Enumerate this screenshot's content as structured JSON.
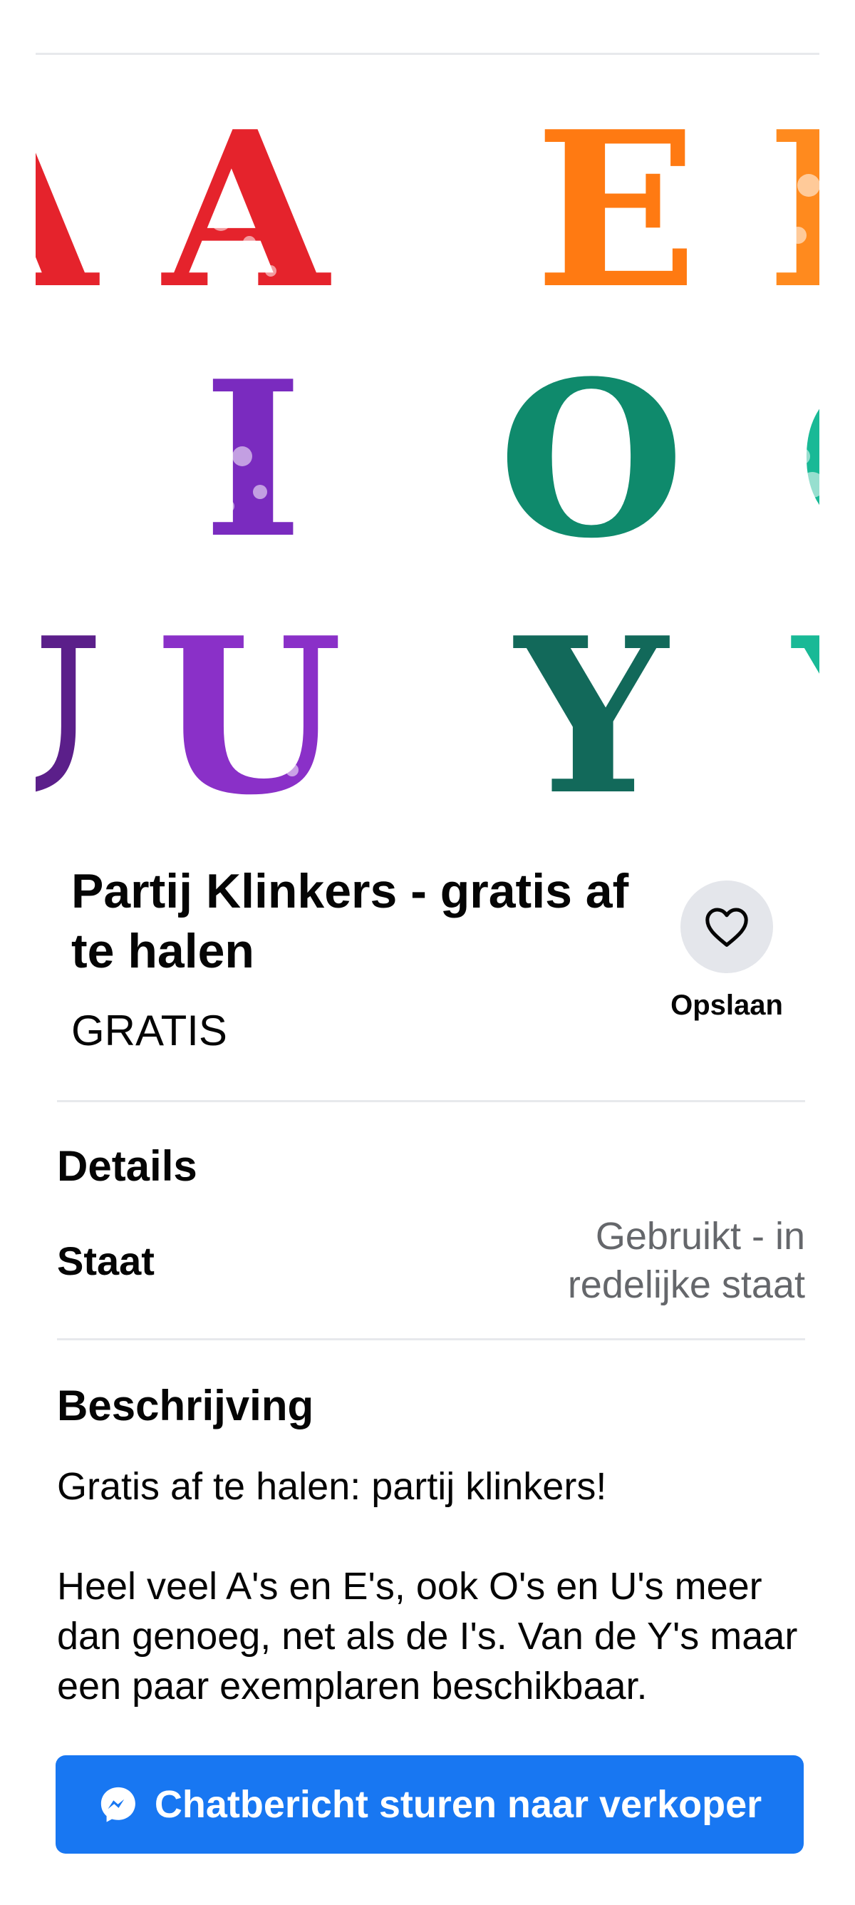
{
  "listing": {
    "title": "Partij Klinkers - gratis af te halen",
    "price": "GRATIS"
  },
  "save": {
    "label": "Opslaan",
    "icon": "heart-outline-icon"
  },
  "details": {
    "heading": "Details",
    "condition_label": "Staat",
    "condition_value": "Gebruikt - in redelijke staat"
  },
  "description": {
    "heading": "Beschrijving",
    "paragraph1": "Gratis af te halen: partij klinkers!",
    "paragraph2": "Heel veel A's en E's, ook O's en U's meer dan genoeg, net als de I's. Van de Y's maar een paar exemplaren beschikbaar."
  },
  "photo": {
    "letters": [
      "A",
      "E",
      "I",
      "O",
      "U",
      "Y"
    ],
    "colors": {
      "red": "#e5232c",
      "orange": "#ff7a12",
      "purple": "#7a2bbf",
      "teal": "#0f8a6c",
      "teal_light": "#19b996",
      "dark_teal": "#12695a"
    }
  },
  "cta": {
    "label": "Chatbericht sturen naar verkoper",
    "icon": "messenger-icon"
  },
  "colors": {
    "brand_blue": "#1877f2",
    "secondary_text": "#65676b",
    "divider": "#e7e9ec",
    "save_bg": "#e4e6eb"
  }
}
